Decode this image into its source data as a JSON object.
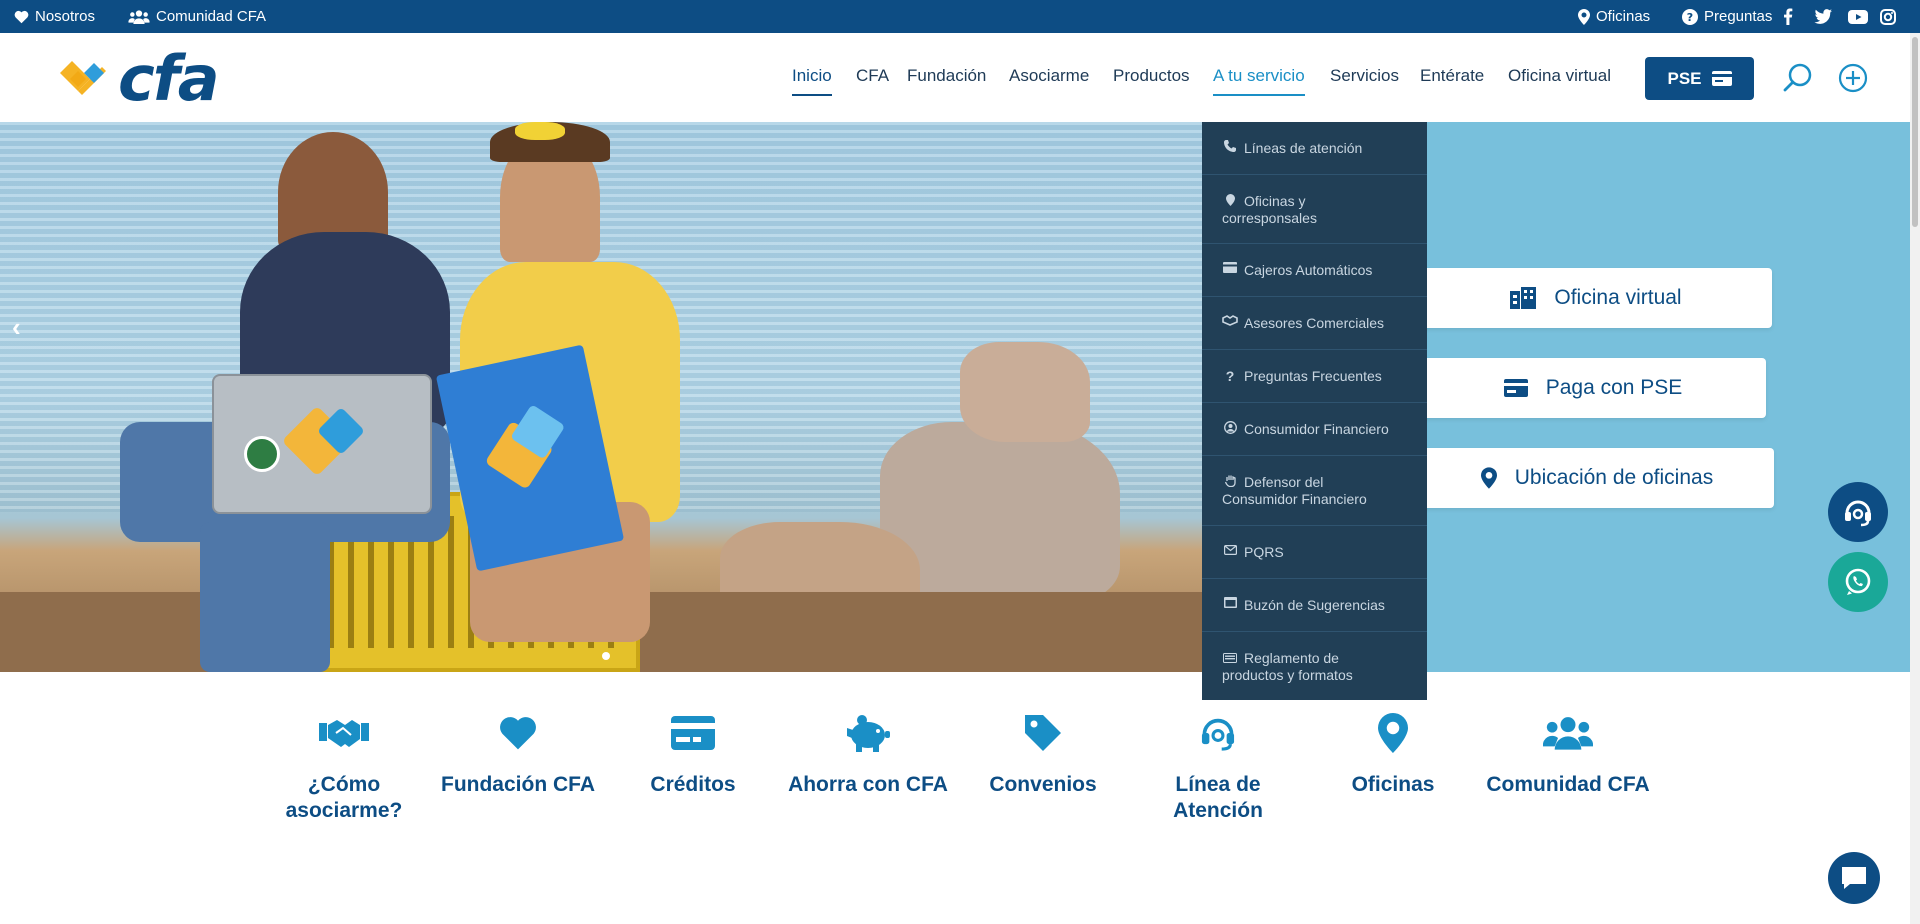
{
  "topbar": {
    "nosotros": "Nosotros",
    "comunidad": "Comunidad CFA",
    "oficinas": "Oficinas",
    "preguntas": "Preguntas",
    "social_icons": [
      "facebook-icon",
      "twitter-icon",
      "youtube-icon",
      "instagram-icon"
    ]
  },
  "header": {
    "logo_text": "cfa",
    "nav": [
      "Inicio",
      "CFA",
      "Fundación",
      "Asociarme",
      "Productos",
      "A tu servicio",
      "Servicios",
      "Entérate",
      "Oficina virtual"
    ],
    "active_nav": "Inicio",
    "open_nav": "A tu servicio",
    "pse_label": "PSE"
  },
  "dropdown": [
    {
      "icon": "phone-icon",
      "lines": [
        "Líneas de atención"
      ]
    },
    {
      "icon": "map-pin-icon",
      "lines": [
        "Oficinas y",
        "corresponsales"
      ]
    },
    {
      "icon": "card-icon",
      "lines": [
        "Cajeros Automáticos"
      ]
    },
    {
      "icon": "handshake-icon",
      "lines": [
        "Asesores Comerciales"
      ]
    },
    {
      "icon": "question-icon",
      "lines": [
        "Preguntas Frecuentes"
      ]
    },
    {
      "icon": "user-circle-icon",
      "lines": [
        "Consumidor Financiero"
      ]
    },
    {
      "icon": "hand-icon",
      "lines": [
        "Defensor del",
        "Consumidor Financiero"
      ]
    },
    {
      "icon": "envelope-icon",
      "lines": [
        "PQRS"
      ]
    },
    {
      "icon": "inbox-icon",
      "lines": [
        "Buzón de Sugerencias"
      ]
    },
    {
      "icon": "keyboard-icon",
      "lines": [
        "Reglamento de",
        "productos y formatos"
      ]
    }
  ],
  "hero": {
    "quick_links": [
      "Oficina virtual",
      "Paga con PSE",
      "Ubicación de oficinas"
    ],
    "slide_count": 1,
    "active_slide": 1
  },
  "features": [
    {
      "icon": "handshake-icon",
      "label": "¿Cómo asociarme?"
    },
    {
      "icon": "heart-icon",
      "label": "Fundación CFA"
    },
    {
      "icon": "credit-card-icon",
      "label": "Créditos"
    },
    {
      "icon": "piggy-bank-icon",
      "label": "Ahorra con CFA"
    },
    {
      "icon": "tag-icon",
      "label": "Convenios"
    },
    {
      "icon": "headset-icon",
      "label": "Línea de Atención"
    },
    {
      "icon": "map-pin-icon",
      "label": "Oficinas"
    },
    {
      "icon": "users-icon",
      "label": "Comunidad CFA"
    }
  ],
  "colors": {
    "primary": "#0d4d84",
    "accent": "#1a8fc6",
    "hero_bg": "#78c0dc",
    "dropdown_bg": "#213f56",
    "whatsapp": "#1aa898",
    "logo_yellow": "#f5b324",
    "logo_blue": "#2f9ddb"
  }
}
